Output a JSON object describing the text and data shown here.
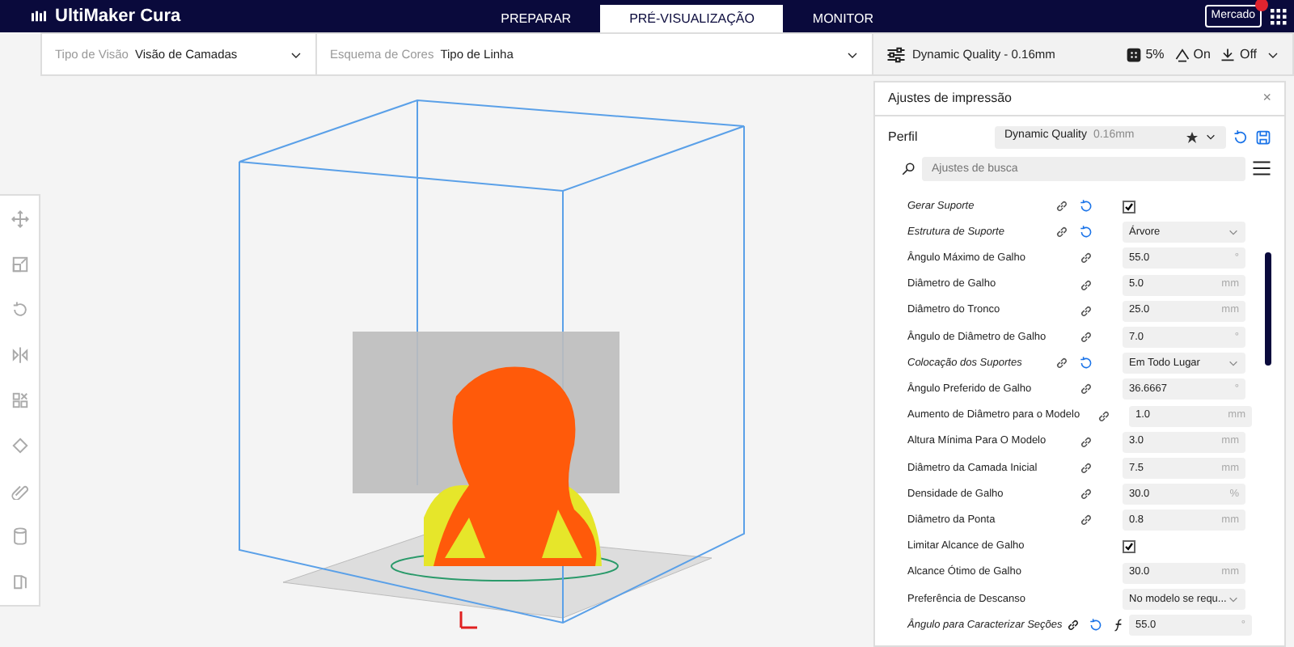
{
  "app": {
    "logo": "UltiMaker Cura"
  },
  "stages": [
    {
      "label": "PREPARAR",
      "selected": false
    },
    {
      "label": "PRÉ-VISUALIZAÇÃO",
      "selected": true
    },
    {
      "label": "MONITOR",
      "selected": false
    }
  ],
  "marketplace": {
    "label": "Mercado",
    "notification": true
  },
  "view_bar": {
    "view_type": {
      "label": "Tipo de Visão",
      "value": "Visão de Camadas"
    },
    "color_scheme": {
      "label": "Esquema de Cores",
      "value": "Tipo de Linha"
    }
  },
  "print_summary": {
    "profile": "Dynamic Quality - 0.16mm",
    "infill": "5%",
    "support": "On",
    "adhesion": "Off"
  },
  "panel": {
    "title": "Ajustes de impressão",
    "close": "×",
    "profile_label": "Perfil",
    "profile": "Dynamic Quality",
    "profile_detail": "0.16mm",
    "search_placeholder": "Ajustes de busca",
    "settings": [
      {
        "label": "Gerar Suporte",
        "kind": "checkbox",
        "checked": true,
        "modified": true,
        "linked": true,
        "formula": false
      },
      {
        "label": "Estrutura de Suporte",
        "kind": "select",
        "value": "Árvore",
        "modified": true,
        "linked": true,
        "formula": false
      },
      {
        "label": "Ângulo Máximo de Galho",
        "kind": "number",
        "value": "55.0",
        "unit": "°",
        "modified": false,
        "linked": true,
        "formula": false
      },
      {
        "label": "Diâmetro de Galho",
        "kind": "number",
        "value": "5.0",
        "unit": "mm",
        "modified": false,
        "linked": true,
        "formula": false
      },
      {
        "label": "Diâmetro do Tronco",
        "kind": "number",
        "value": "25.0",
        "unit": "mm",
        "modified": false,
        "linked": true,
        "formula": false
      },
      {
        "label": "Ângulo de Diâmetro de Galho",
        "kind": "number",
        "value": "7.0",
        "unit": "°",
        "modified": false,
        "linked": true,
        "formula": false
      },
      {
        "label": "Colocação dos Suportes",
        "kind": "select",
        "value": "Em Todo Lugar",
        "modified": true,
        "linked": true,
        "formula": false
      },
      {
        "label": "Ângulo Preferido de Galho",
        "kind": "number",
        "value": "36.6667",
        "unit": "°",
        "modified": false,
        "linked": true,
        "formula": false
      },
      {
        "label": "Aumento de Diâmetro para o Modelo",
        "kind": "number",
        "value": "1.0",
        "unit": "mm",
        "modified": false,
        "linked": true,
        "formula": false
      },
      {
        "label": "Altura Mínima Para O Modelo",
        "kind": "number",
        "value": "3.0",
        "unit": "mm",
        "modified": false,
        "linked": true,
        "formula": false
      },
      {
        "label": "Diâmetro da Camada Inicial",
        "kind": "number",
        "value": "7.5",
        "unit": "mm",
        "modified": false,
        "linked": true,
        "formula": false
      },
      {
        "label": "Densidade de Galho",
        "kind": "number",
        "value": "30.0",
        "unit": "%",
        "modified": false,
        "linked": true,
        "formula": false
      },
      {
        "label": "Diâmetro da Ponta",
        "kind": "number",
        "value": "0.8",
        "unit": "mm",
        "modified": false,
        "linked": true,
        "formula": false
      },
      {
        "label": "Limitar Alcance de Galho",
        "kind": "checkbox",
        "checked": true,
        "modified": false,
        "linked": false,
        "formula": false
      },
      {
        "label": "Alcance Ótimo de Galho",
        "kind": "number",
        "value": "30.0",
        "unit": "mm",
        "modified": false,
        "linked": false,
        "formula": false
      },
      {
        "label": "Preferência de Descanso",
        "kind": "select",
        "value": "No modelo se requ...",
        "modified": false,
        "linked": false,
        "formula": false
      },
      {
        "label": "Ângulo para Caracterizar Seções",
        "kind": "number",
        "value": "55.0",
        "unit": "°",
        "modified": true,
        "linked": true,
        "formula": true
      }
    ]
  }
}
